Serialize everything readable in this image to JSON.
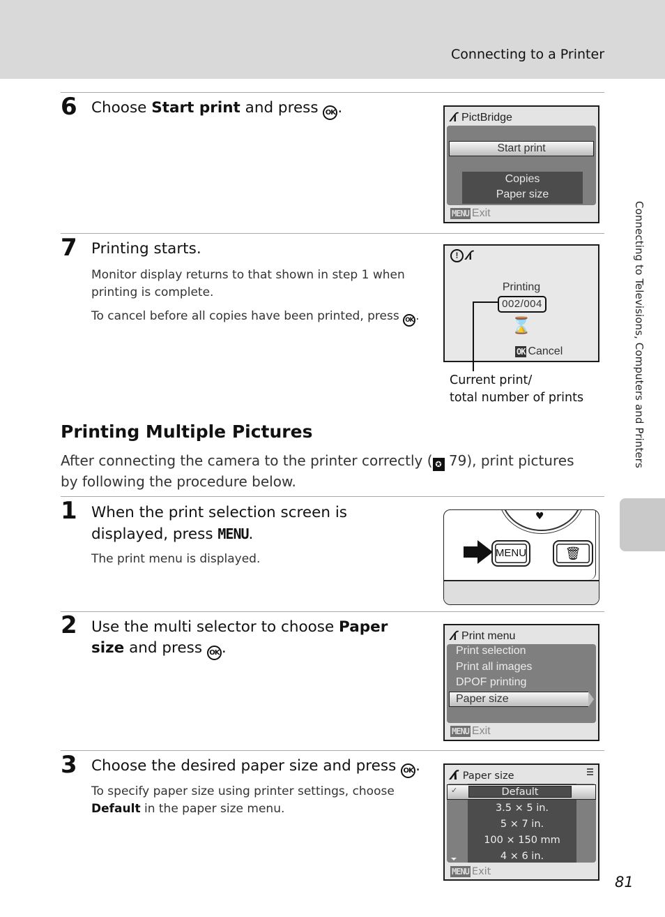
{
  "header": {
    "title": "Connecting to a Printer"
  },
  "side_tab": {
    "label": "Connecting to Televisions, Computers and Printers"
  },
  "page_number": "81",
  "steps_top": [
    {
      "number": "6",
      "title_pre": "Choose ",
      "title_bold": "Start print",
      "title_post": " and press",
      "ok_icon": "OK",
      "screen": {
        "header_icon": "pictbridge-icon",
        "header": "PictBridge",
        "selected": "Start print",
        "items": [
          "Copies",
          "Paper size"
        ],
        "footer_badge": "MENU",
        "footer": "Exit"
      }
    },
    {
      "number": "7",
      "title": "Printing starts.",
      "desc1": "Monitor display returns to that shown in step 1 when printing is complete.",
      "desc2": "To cancel before all copies have been printed, press",
      "ok_icon": "OK",
      "screen": {
        "icons": [
          "warning-icon",
          "pictbridge-icon"
        ],
        "status": "Printing",
        "counter": "002/004",
        "hourglass": "⌛",
        "cancel_badge": "OK",
        "cancel": "Cancel"
      },
      "callout": {
        "line1": "Current print/",
        "line2": "total number of prints"
      }
    }
  ],
  "section": {
    "title": "Printing Multiple Pictures",
    "intro_pre": "After connecting the camera to the printer correctly (",
    "intro_ref": "79",
    "intro_post": "), print pictures by following the procedure below."
  },
  "steps_bottom": [
    {
      "number": "1",
      "title_pre": "When the print selection screen is displayed, press ",
      "title_key": "MENU",
      "title_post": ".",
      "desc": "The print menu is displayed.",
      "illustration": {
        "menu_button": "MENU",
        "delete_icon": "trash-icon"
      }
    },
    {
      "number": "2",
      "title_pre": "Use the multi selector to choose ",
      "title_bold": "Paper size",
      "title_post": " and press",
      "ok_icon": "OK",
      "screen": {
        "header": "Print menu",
        "items": [
          "Print selection",
          "Print all images",
          "DPOF printing"
        ],
        "selected": "Paper size",
        "footer_badge": "MENU",
        "footer": "Exit"
      }
    },
    {
      "number": "3",
      "title": "Choose the desired paper size and press",
      "ok_icon": "OK",
      "desc_pre": "To specify paper size using printer settings, choose ",
      "desc_bold": "Default",
      "desc_post": " in the paper size menu.",
      "screen": {
        "header": "Paper size",
        "selected": "Default",
        "items": [
          "3.5 × 5 in.",
          "5 × 7 in.",
          "100 × 150 mm",
          "4 × 6 in."
        ],
        "footer_badge": "MENU",
        "footer": "Exit"
      }
    }
  ]
}
